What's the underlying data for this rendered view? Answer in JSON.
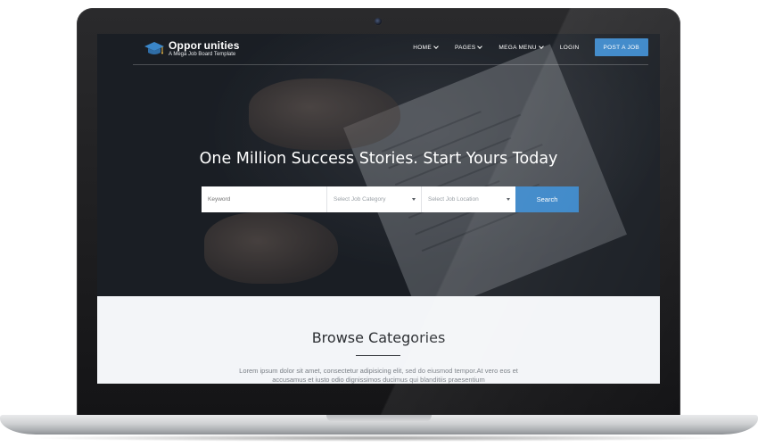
{
  "brand": {
    "name": "Oppor unities",
    "tagline": "A Mega Job Board Template"
  },
  "nav": {
    "items": [
      {
        "label": "HOME",
        "dropdown": true
      },
      {
        "label": "PAGES",
        "dropdown": true
      },
      {
        "label": "MEGA MENU",
        "dropdown": true
      },
      {
        "label": "LOGIN",
        "dropdown": false
      }
    ],
    "cta_label": "POST A JOB"
  },
  "hero": {
    "headline": "One Million Success Stories. Start Yours Today"
  },
  "search": {
    "keyword_placeholder": "Keyword",
    "category_placeholder": "Select Job Category",
    "location_placeholder": "Select Job Location",
    "button_label": "Search"
  },
  "categories": {
    "title": "Browse Categories",
    "description": "Lorem ipsum dolor sit amet, consectetur adipisicing elit, sed do eiusmod tempor.At vero eos et accusamus et iusto odio dignissimos ducimus qui blanditiis praesentium"
  },
  "colors": {
    "accent": "#3a86c8",
    "lower_bg": "#f3f5f8",
    "laptop_bezel": "#1c1c1e"
  },
  "icons": {
    "logo": "graduation-cap-icon",
    "dropdown": "chevron-down-icon",
    "select_caret": "caret-down-icon",
    "camera": "webcam-icon"
  }
}
